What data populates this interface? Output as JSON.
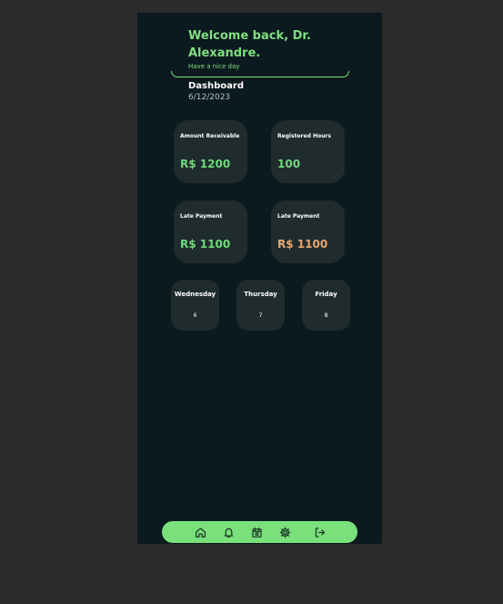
{
  "header": {
    "welcome": "Welcome back, Dr. Alexandre.",
    "subtitle": "Have a nice day"
  },
  "dashboard": {
    "title": "Dashboard",
    "date": "6/12/2023"
  },
  "cards": [
    {
      "label": "Amount Receivable",
      "value": "R$ 1200",
      "color": "#6fd97a"
    },
    {
      "label": "Registered Hours",
      "value": "100",
      "color": "#6fd97a"
    },
    {
      "label": "Late Payment",
      "value": "R$ 1100",
      "color": "#6fd97a"
    },
    {
      "label": "Late Payment",
      "value": "R$ 1100",
      "color": "#e8a870"
    }
  ],
  "days": [
    {
      "name": "Wednesday",
      "num": "6"
    },
    {
      "name": "Thursday",
      "num": "7"
    },
    {
      "name": "Friday",
      "num": "8"
    }
  ],
  "nav": {
    "icons": [
      "home-icon",
      "bell-icon",
      "calendar-icon",
      "gear-icon",
      "logout-icon"
    ],
    "accent": "#7ae07c"
  },
  "colors": {
    "background": "#0b1a1f",
    "card": "#1f2b2d",
    "accent_green": "#7ee07e",
    "accent_orange": "#e8a870"
  }
}
